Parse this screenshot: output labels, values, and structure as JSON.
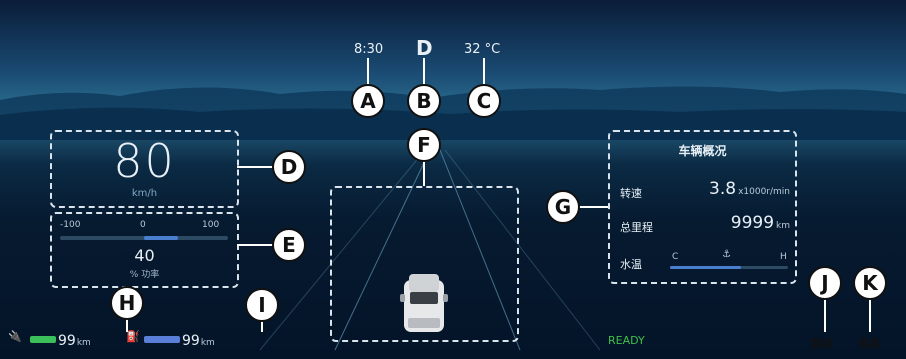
{
  "status_bar": {
    "time": "8:30",
    "gear": "D",
    "temperature": "32 °C"
  },
  "speed": {
    "value": "80",
    "unit": "km/h"
  },
  "power": {
    "scale_min": "-100",
    "scale_mid": "0",
    "scale_max": "100",
    "value": "40",
    "label": "% 功率",
    "level_percent": 40
  },
  "vehicle": {
    "title": "车辆概况",
    "rpm_label": "转速",
    "rpm_value": "3.8",
    "rpm_unit": "x1000r/min",
    "odometer_label": "总里程",
    "odometer_value": "9999",
    "odometer_unit": "km",
    "water_temp_label": "水温",
    "temp_low": "C",
    "temp_high": "H",
    "water_temp_level": 0.6
  },
  "ranges": {
    "electric_value": "99",
    "electric_unit": "km",
    "fuel_value": "99",
    "fuel_unit": "km"
  },
  "status": {
    "ready": "READY"
  },
  "modes": {
    "drive_mode": "混动",
    "driving_style": "标准"
  },
  "callouts": {
    "a": "A",
    "b": "B",
    "c": "C",
    "d": "D",
    "e": "E",
    "f": "F",
    "g": "G",
    "h": "H",
    "i": "I",
    "j": "J",
    "k": "K"
  },
  "colors": {
    "accent_blue": "#4a7fd0",
    "ready_green": "#3fbf4a",
    "battery_green": "#3bbf5a",
    "fuel_blue": "#5a7fd8"
  }
}
